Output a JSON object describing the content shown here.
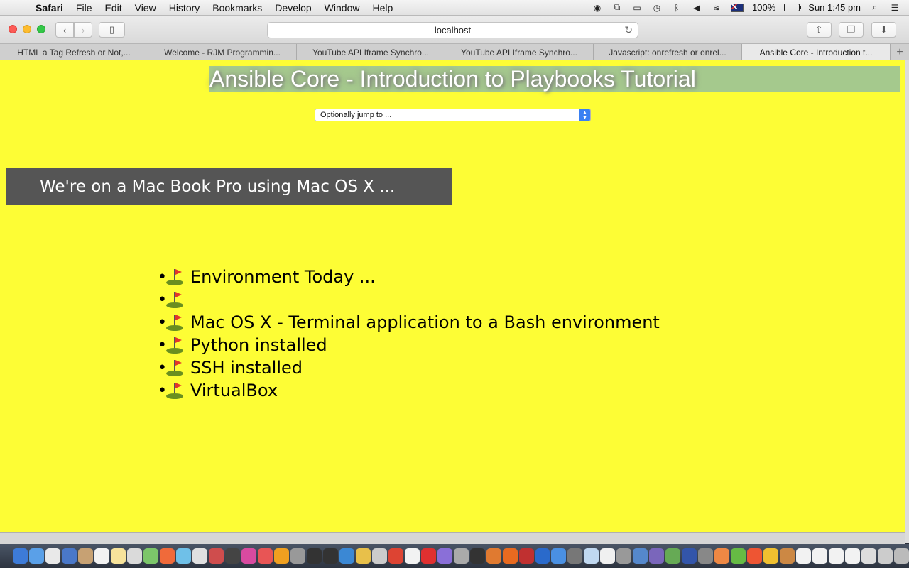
{
  "menubar": {
    "app": "Safari",
    "items": [
      "File",
      "Edit",
      "View",
      "History",
      "Bookmarks",
      "Develop",
      "Window",
      "Help"
    ],
    "battery": "100%",
    "clock": "Sun 1:45 pm"
  },
  "toolbar": {
    "url": "localhost"
  },
  "tabs": [
    {
      "label": "HTML a Tag Refresh or Not,..."
    },
    {
      "label": "Welcome - RJM Programmin..."
    },
    {
      "label": "YouTube API Iframe Synchro..."
    },
    {
      "label": "YouTube API Iframe Synchro..."
    },
    {
      "label": "Javascript: onrefresh or onrel..."
    },
    {
      "label": "Ansible Core - Introduction t..."
    }
  ],
  "page": {
    "title": "Ansible Core - Introduction to Playbooks Tutorial",
    "jump_select": "Optionally jump to ...",
    "mac_note": "We're on a Mac Book Pro using Mac OS X ...",
    "bullets": [
      "Environment Today ...",
      "",
      "Mac OS X - Terminal application to a Bash environment",
      "Python installed",
      "SSH installed",
      "VirtualBox"
    ]
  },
  "colors": {
    "page_background": "#fdfd35",
    "title_band": "#a5c98d",
    "note_box": "#555555"
  },
  "icons": {
    "bullet_icon": "golf-flag-icon"
  },
  "dock_colors": [
    "#3d7bd8",
    "#5aa0e8",
    "#e9e9e9",
    "#4a78c9",
    "#c7a173",
    "#f2f2f2",
    "#f7e39b",
    "#dadada",
    "#7cc66a",
    "#f06a3a",
    "#6fc0e8",
    "#e0e0e0",
    "#cf4d4d",
    "#444",
    "#d84aa0",
    "#e85555",
    "#f0a020",
    "#999",
    "#333",
    "#333",
    "#3b88d4",
    "#e8c04a",
    "#cccccc",
    "#dd4433",
    "#f2f2f2",
    "#e03030",
    "#8a6fd8",
    "#aaa",
    "#333",
    "#e07a30",
    "#e86a20",
    "#c03030",
    "#2a6acb",
    "#4a90e2",
    "#777",
    "#c0d8f0",
    "#f0f0f0",
    "#999",
    "#5588cc",
    "#7a66bb",
    "#66aa55",
    "#3355aa",
    "#888",
    "#e84",
    "#66bb44",
    "#ee5533",
    "#f0c030",
    "#cc8844",
    "#f2f2f2",
    "#f2f2f2",
    "#f2f2f2",
    "#f2f2f2",
    "#ddd",
    "#ccc",
    "#bbb"
  ]
}
